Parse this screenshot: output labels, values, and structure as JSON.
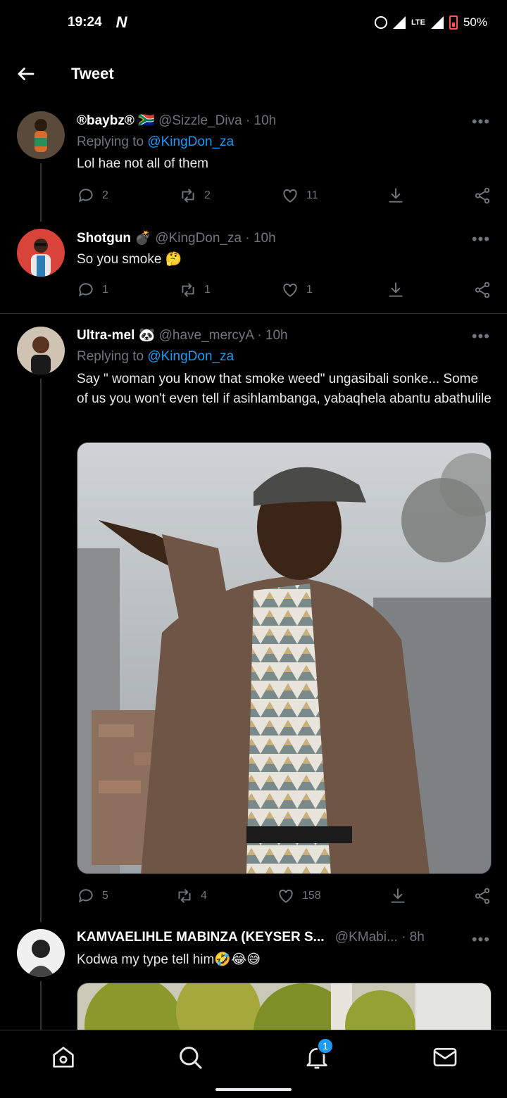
{
  "status_bar": {
    "time": "19:24",
    "network_app": "N",
    "network_type": "LTE",
    "battery": "50%"
  },
  "header": {
    "title": "Tweet"
  },
  "tweets": [
    {
      "name": "®baybz®",
      "flag": "🇿🇦",
      "handle": "@Sizzle_Diva",
      "time": "· 10h",
      "replying_label": "Replying to",
      "replying_to": "@KingDon_za",
      "text": "Lol hae not all of them",
      "replies": "2",
      "retweets": "2",
      "likes": "11"
    },
    {
      "name": "Shotgun",
      "name_emoji": "💣",
      "handle": "@KingDon_za",
      "time": "· 10h",
      "text": "So you smoke 🤔",
      "replies": "1",
      "retweets": "1",
      "likes": "1"
    },
    {
      "name": "Ultra-mel",
      "name_emoji": "🐼",
      "handle": "@have_mercyA",
      "time": "· 10h",
      "replying_label": "Replying to",
      "replying_to": "@KingDon_za",
      "text": "Say \" woman you know that smoke weed\" ungasibali sonke... Some of us you won't even tell if asihlambanga, yabaqhela abantu abathulile",
      "replies": "5",
      "retweets": "4",
      "likes": "158"
    },
    {
      "name": "KAMVAELIHLE MABINZA (KEYSER S...",
      "handle": "@KMabi...",
      "time": "· 8h",
      "text": "Kodwa my type tell him🤣😂😅"
    }
  ],
  "more_label": "•••",
  "notifications_badge": "1",
  "colors": {
    "accent": "#1d9bf0",
    "muted": "#71767b",
    "background": "#000000"
  }
}
